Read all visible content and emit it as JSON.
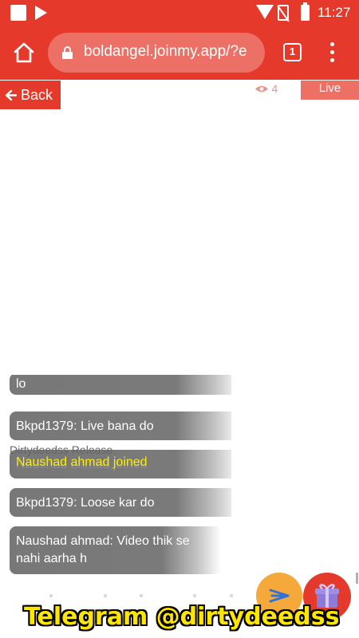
{
  "status_bar": {
    "time": "11:27"
  },
  "browser": {
    "url": "boldangel.joinmy.app/?e",
    "tab_count": "1"
  },
  "page": {
    "back_label": "Back",
    "viewer_count": "4",
    "live_label": "Live"
  },
  "chat": {
    "messages": [
      {
        "text": "lo"
      },
      {
        "text": "Bkpd1379: Live bana do"
      },
      {
        "text": "Naushad ahmad joined"
      },
      {
        "text": "Bkpd1379: Loose kar do"
      },
      {
        "text": "Naushad ahmad: Video thik se nahi aarha h"
      }
    ],
    "overlay_line1": "Dirtydeedss Release",
    "overlay_line2": "Naushad ahmad joined"
  },
  "watermark": "Telegram @dirtydeedss",
  "colors": {
    "brand_red": "#e53a2b",
    "live_badge": "#ee7065",
    "send_button": "#f6a93b",
    "chat_bubble": "#787878",
    "join_text": "#ffee00"
  },
  "icons": [
    "home-icon",
    "lock-icon",
    "tabs-icon",
    "more-vert-icon",
    "eye-icon",
    "arrow-left-icon",
    "send-icon",
    "gift-icon",
    "wifi-icon",
    "no-sim-icon",
    "battery-icon",
    "play-store-icon"
  ]
}
